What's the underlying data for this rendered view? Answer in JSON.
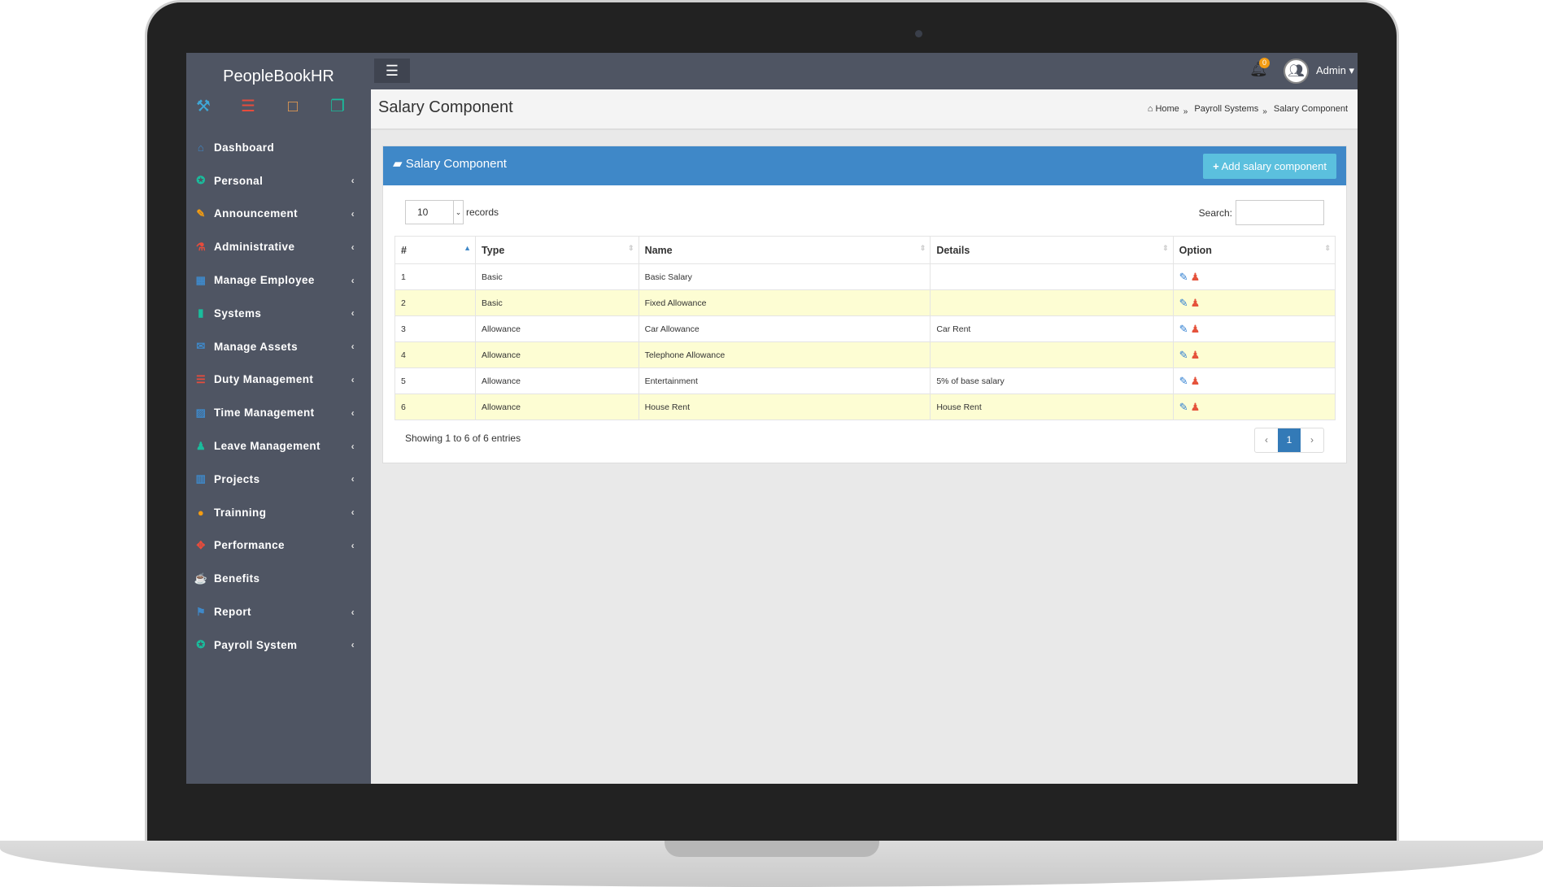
{
  "sidebar": {
    "brand": "PeopleBookHR",
    "items": [
      {
        "label": "Dashboard",
        "icon": "home-icon",
        "color": "#3f88c8",
        "chev": false
      },
      {
        "label": "Personal",
        "icon": "user-icon",
        "color": "#1abc9c",
        "chev": true
      },
      {
        "label": "Announcement",
        "icon": "pencil-icon",
        "color": "#f39c12",
        "chev": true
      },
      {
        "label": "Administrative",
        "icon": "flask-icon",
        "color": "#e74c3c",
        "chev": true
      },
      {
        "label": "Manage Employee",
        "icon": "table-icon",
        "color": "#3f88c8",
        "chev": true
      },
      {
        "label": "Systems",
        "icon": "bar-chart-icon",
        "color": "#1abc9c",
        "chev": true
      },
      {
        "label": "Manage Assets",
        "icon": "envelope-icon",
        "color": "#3f88c8",
        "chev": true
      },
      {
        "label": "Duty Management",
        "icon": "list-icon",
        "color": "#e74c3c",
        "chev": true
      },
      {
        "label": "Time Management",
        "icon": "picture-icon",
        "color": "#3f88c8",
        "chev": true
      },
      {
        "label": "Leave Management",
        "icon": "group-icon",
        "color": "#1abc9c",
        "chev": true
      },
      {
        "label": "Projects",
        "icon": "book-icon",
        "color": "#3f88c8",
        "chev": true
      },
      {
        "label": "Trainning",
        "icon": "comment-icon",
        "color": "#f39c12",
        "chev": true
      },
      {
        "label": "Performance",
        "icon": "move-icon",
        "color": "#e74c3c",
        "chev": true
      },
      {
        "label": "Benefits",
        "icon": "coffee-icon",
        "color": "#fff",
        "chev": false
      },
      {
        "label": "Report",
        "icon": "flag-icon",
        "color": "#3f88c8",
        "chev": true
      },
      {
        "label": "Payroll System",
        "icon": "award-icon",
        "color": "#1abc9c",
        "chev": true
      }
    ]
  },
  "topbar": {
    "notifications": "0",
    "user": "Admin"
  },
  "page": {
    "title": "Salary Component",
    "breadcrumb": [
      "Home",
      "Payroll Systems",
      "Salary Component"
    ]
  },
  "panel": {
    "title": "Salary Component",
    "add_label": "Add salary component",
    "page_length": "10",
    "records_label": "records",
    "search_label": "Search:",
    "columns": [
      "#",
      "Type",
      "Name",
      "Details",
      "Option"
    ],
    "rows": [
      {
        "n": "1",
        "type": "Basic",
        "name": "Basic Salary",
        "details": ""
      },
      {
        "n": "2",
        "type": "Basic",
        "name": "Fixed Allowance",
        "details": ""
      },
      {
        "n": "3",
        "type": "Allowance",
        "name": "Car Allowance",
        "details": "Car Rent"
      },
      {
        "n": "4",
        "type": "Allowance",
        "name": "Telephone Allowance",
        "details": ""
      },
      {
        "n": "5",
        "type": "Allowance",
        "name": "Entertainment",
        "details": "5% of base salary"
      },
      {
        "n": "6",
        "type": "Allowance",
        "name": "House Rent",
        "details": "House Rent"
      }
    ],
    "info": "Showing 1 to 6 of 6 entries",
    "prev": "‹",
    "page": "1",
    "next": "›"
  }
}
